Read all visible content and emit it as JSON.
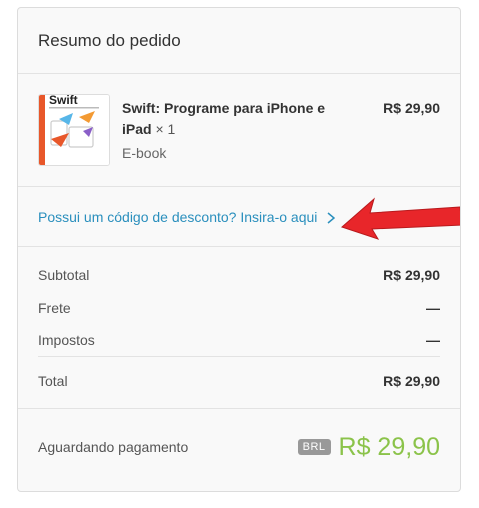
{
  "header": {
    "title": "Resumo do pedido"
  },
  "product": {
    "book_cover_title": "Swift",
    "name": "Swift: Programe para iPhone e iPad",
    "quantity": "× 1",
    "format": "E-book",
    "price": "R$ 29,90"
  },
  "discount": {
    "link_text": "Possui um código de desconto? Insira-o aqui",
    "arrow_color": "#e8262a"
  },
  "totals": {
    "rows": [
      {
        "label": "Subtotal",
        "value": "R$ 29,90"
      },
      {
        "label": "Frete",
        "value": "—"
      },
      {
        "label": "Impostos",
        "value": "—"
      }
    ],
    "total_label": "Total",
    "total_value": "R$ 29,90"
  },
  "footer": {
    "status": "Aguardando pagamento",
    "currency_code": "BRL",
    "amount": "R$ 29,90",
    "amount_color": "#8bc34a"
  }
}
